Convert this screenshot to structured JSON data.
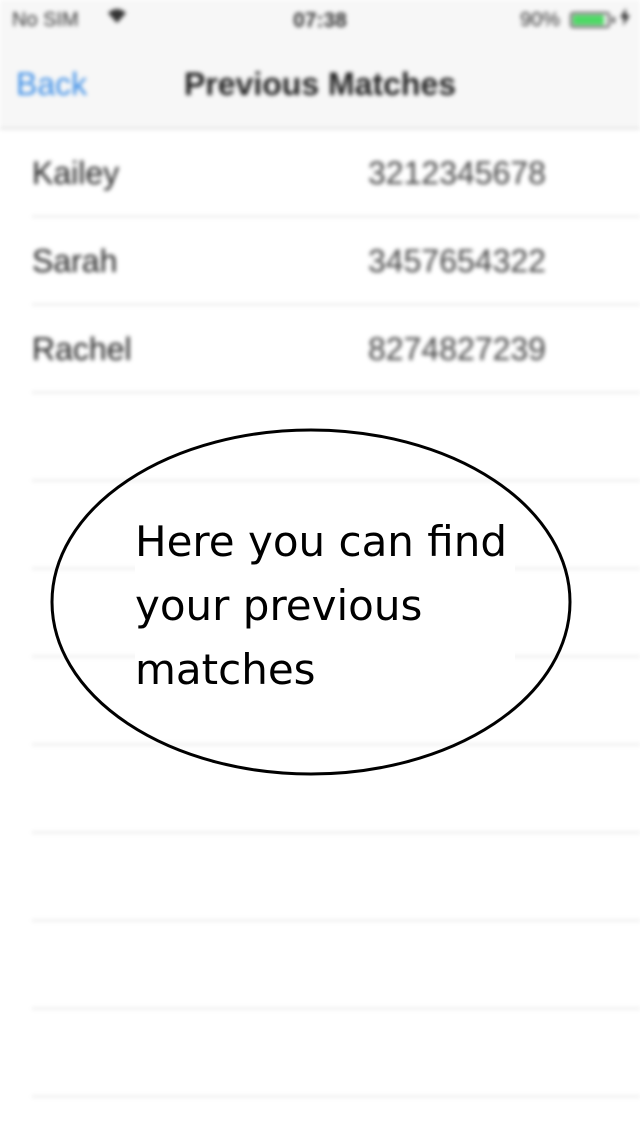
{
  "status_bar": {
    "carrier": "No SIM",
    "wifi_icon": "wifi-icon",
    "time": "07:38",
    "battery_percent": "90%",
    "battery_level": 0.9,
    "battery_color": "#4cd964",
    "charging_icon": "charging-icon"
  },
  "nav": {
    "back_label": "Back",
    "title": "Previous Matches",
    "accent_color": "#3b8de6"
  },
  "matches": [
    {
      "name": "Kailey",
      "phone": "3212345678"
    },
    {
      "name": "Sarah",
      "phone": "3457654322"
    },
    {
      "name": "Rachel",
      "phone": "8274827239"
    },
    {
      "name": "",
      "phone": ""
    },
    {
      "name": "",
      "phone": ""
    },
    {
      "name": "",
      "phone": ""
    },
    {
      "name": "",
      "phone": ""
    },
    {
      "name": "",
      "phone": ""
    },
    {
      "name": "",
      "phone": ""
    },
    {
      "name": "",
      "phone": ""
    },
    {
      "name": "",
      "phone": ""
    }
  ],
  "callout": {
    "text": "Here you can find your previous matches"
  }
}
